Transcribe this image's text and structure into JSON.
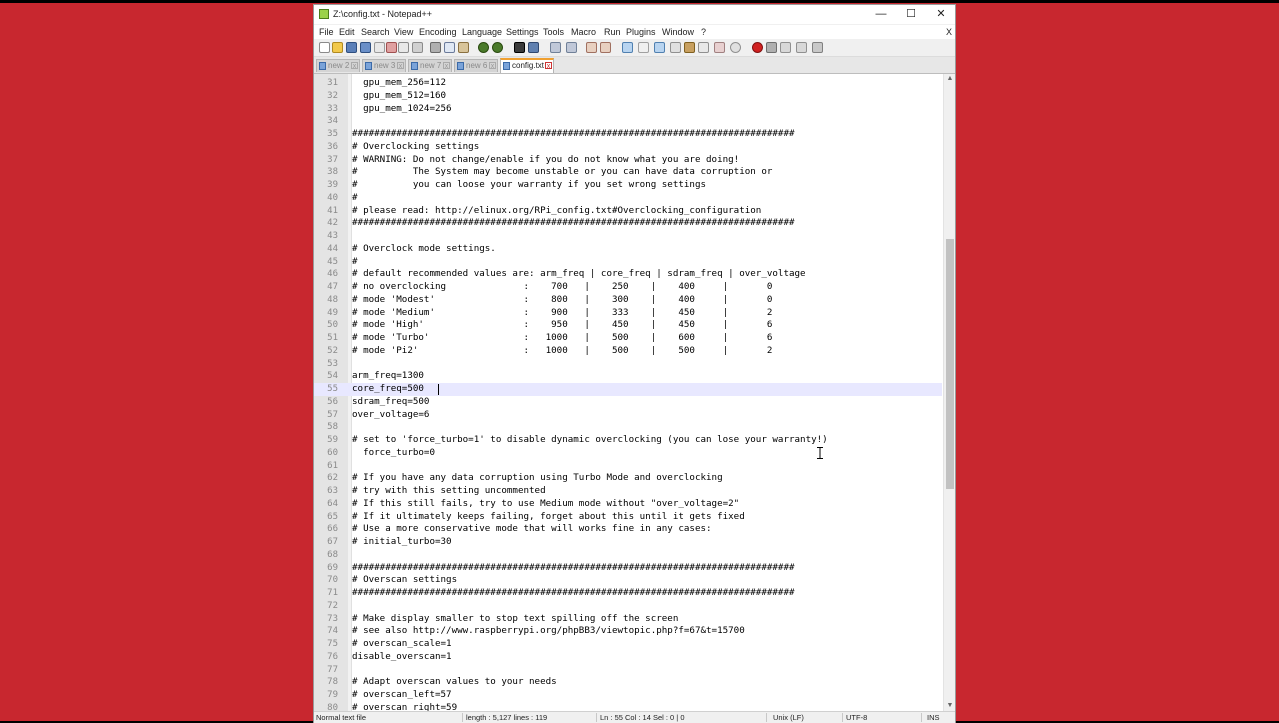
{
  "window": {
    "title": "Z:\\config.txt - Notepad++",
    "controls": [
      "—",
      "☐",
      "✕"
    ]
  },
  "menu": [
    "File",
    "Edit",
    "Search",
    "View",
    "Encoding",
    "Language",
    "Settings",
    "Tools",
    "Macro",
    "Run",
    "Plugins",
    "Window",
    "?"
  ],
  "menu_close": "X",
  "tabs": [
    {
      "label": "new 2",
      "active": false
    },
    {
      "label": "new 3",
      "active": false
    },
    {
      "label": "new 7",
      "active": false
    },
    {
      "label": "new 6",
      "active": false
    },
    {
      "label": "config.txt",
      "active": true
    }
  ],
  "editor": {
    "current_line": 55,
    "lines": [
      {
        "n": "31",
        "t": "  gpu_mem_256=112"
      },
      {
        "n": "32",
        "t": "  gpu_mem_512=160"
      },
      {
        "n": "33",
        "t": "  gpu_mem_1024=256"
      },
      {
        "n": "34",
        "t": ""
      },
      {
        "n": "35",
        "t": "################################################################################"
      },
      {
        "n": "36",
        "t": "# Overclocking settings"
      },
      {
        "n": "37",
        "t": "# WARNING: Do not change/enable if you do not know what you are doing!"
      },
      {
        "n": "38",
        "t": "#          The System may become unstable or you can have data corruption or"
      },
      {
        "n": "39",
        "t": "#          you can loose your warranty if you set wrong settings"
      },
      {
        "n": "40",
        "t": "#"
      },
      {
        "n": "41",
        "t": "# please read: http://elinux.org/RPi_config.txt#Overclocking_configuration"
      },
      {
        "n": "42",
        "t": "################################################################################"
      },
      {
        "n": "43",
        "t": ""
      },
      {
        "n": "44",
        "t": "# Overclock mode settings."
      },
      {
        "n": "45",
        "t": "#"
      },
      {
        "n": "46",
        "t": "# default recommended values are: arm_freq | core_freq | sdram_freq | over_voltage"
      },
      {
        "n": "47",
        "t": "# no overclocking              :    700   |    250    |    400     |       0"
      },
      {
        "n": "48",
        "t": "# mode 'Modest'                :    800   |    300    |    400     |       0"
      },
      {
        "n": "49",
        "t": "# mode 'Medium'                :    900   |    333    |    450     |       2"
      },
      {
        "n": "50",
        "t": "# mode 'High'                  :    950   |    450    |    450     |       6"
      },
      {
        "n": "51",
        "t": "# mode 'Turbo'                 :   1000   |    500    |    600     |       6"
      },
      {
        "n": "52",
        "t": "# mode 'Pi2'                   :   1000   |    500    |    500     |       2"
      },
      {
        "n": "53",
        "t": ""
      },
      {
        "n": "54",
        "t": "arm_freq=1300"
      },
      {
        "n": "55",
        "t": "core_freq=500"
      },
      {
        "n": "56",
        "t": "sdram_freq=500"
      },
      {
        "n": "57",
        "t": "over_voltage=6"
      },
      {
        "n": "58",
        "t": ""
      },
      {
        "n": "59",
        "t": "# set to 'force_turbo=1' to disable dynamic overclocking (you can lose your warranty!)"
      },
      {
        "n": "60",
        "t": "  force_turbo=0"
      },
      {
        "n": "61",
        "t": ""
      },
      {
        "n": "62",
        "t": "# If you have any data corruption using Turbo Mode and overclocking"
      },
      {
        "n": "63",
        "t": "# try with this setting uncommented"
      },
      {
        "n": "64",
        "t": "# If this still fails, try to use Medium mode without \"over_voltage=2\""
      },
      {
        "n": "65",
        "t": "# If it ultimately keeps failing, forget about this until it gets fixed"
      },
      {
        "n": "66",
        "t": "# Use a more conservative mode that will works fine in any cases:"
      },
      {
        "n": "67",
        "t": "# initial_turbo=30"
      },
      {
        "n": "68",
        "t": ""
      },
      {
        "n": "69",
        "t": "################################################################################"
      },
      {
        "n": "70",
        "t": "# Overscan settings"
      },
      {
        "n": "71",
        "t": "################################################################################"
      },
      {
        "n": "72",
        "t": ""
      },
      {
        "n": "73",
        "t": "# Make display smaller to stop text spilling off the screen"
      },
      {
        "n": "74",
        "t": "# see also http://www.raspberrypi.org/phpBB3/viewtopic.php?f=67&t=15700"
      },
      {
        "n": "75",
        "t": "# overscan_scale=1"
      },
      {
        "n": "76",
        "t": "disable_overscan=1"
      },
      {
        "n": "77",
        "t": ""
      },
      {
        "n": "78",
        "t": "# Adapt overscan values to your needs"
      },
      {
        "n": "79",
        "t": "# overscan_left=57"
      },
      {
        "n": "80",
        "t": "# overscan_right=59"
      }
    ]
  },
  "status": {
    "type": "Normal text file",
    "length": "length : 5,127   lines : 119",
    "position": "Ln : 55   Col : 14   Sel : 0 | 0",
    "eol": "Unix (LF)",
    "encoding": "UTF-8",
    "mode": "INS"
  },
  "colors": {
    "desktop": "#c8272f",
    "current_line": "#e8e8ff",
    "active_tab_accent": "#f0a030"
  }
}
